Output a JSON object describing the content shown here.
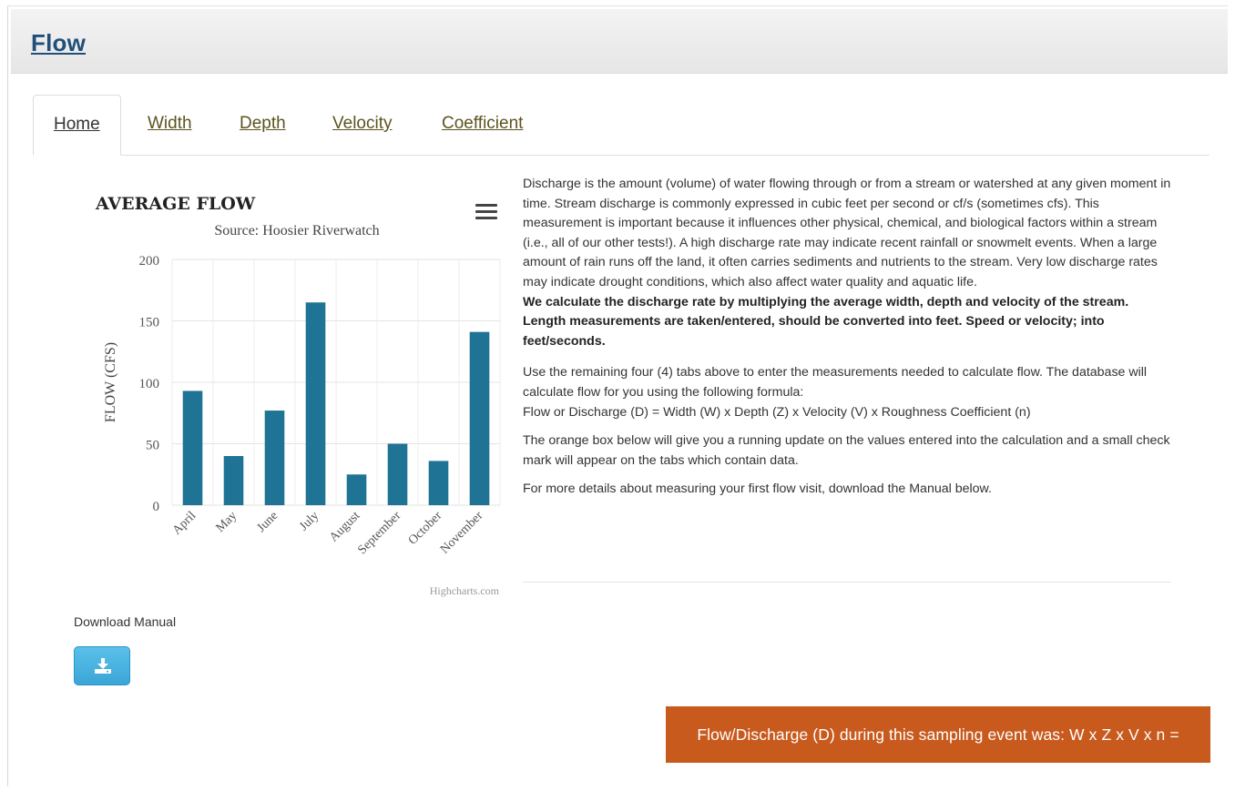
{
  "header": {
    "title": "Flow"
  },
  "tabs": [
    {
      "label": "Home",
      "active": true
    },
    {
      "label": "Width",
      "active": false
    },
    {
      "label": "Depth",
      "active": false
    },
    {
      "label": "Velocity",
      "active": false
    },
    {
      "label": "Coefficient",
      "active": false
    }
  ],
  "chart_data": {
    "type": "bar",
    "title": "AVERAGE FLOW",
    "subtitle": "Source: Hoosier Riverwatch",
    "ylabel": "FLOW (CFS)",
    "xlabel": "",
    "categories": [
      "April",
      "May",
      "June",
      "July",
      "August",
      "September",
      "October",
      "November"
    ],
    "values": [
      93,
      40,
      77,
      165,
      25,
      50,
      36,
      141
    ],
    "ylim": [
      0,
      200
    ],
    "yticks": [
      0,
      50,
      100,
      150,
      200
    ],
    "grid": true,
    "legend": "none",
    "bar_color": "#1f7394",
    "credits": "Highcharts.com"
  },
  "description": {
    "p1": "Discharge is the amount (volume) of water flowing through or from a stream or watershed at any given moment in time. Stream discharge is commonly expressed in cubic feet per second or cf/s (sometimes cfs).  This measurement is important because it influences other physical, chemical, and biological factors within a stream (i.e., all of our other tests!). A high discharge rate may indicate recent rainfall or snowmelt events. When a large amount of rain runs off the land, it often carries sediments and nutrients to the stream. Very low discharge rates may indicate drought conditions, which also affect water quality and aquatic life.",
    "p1_bold": "We calculate the discharge rate by multiplying the average width, depth and velocity of the stream. Length measurements are taken/entered, should be converted into feet.  Speed or velocity; into feet/seconds.",
    "p2": "Use the remaining four (4) tabs above to enter the measurements needed to calculate flow.  The database will calculate flow for you using the following formula:",
    "p2_formula": "Flow or Discharge (D) = Width (W) x Depth (Z) x Velocity (V) x Roughness Coefficient (n)",
    "p3": "The orange box below will give you a running update on the values entered into the calculation and a small check mark will appear on the tabs which contain data.",
    "p4": "For more details about measuring your first flow visit, download the Manual below."
  },
  "download": {
    "label": "Download Manual",
    "icon": "download-icon"
  },
  "result": {
    "text": "Flow/Discharge (D) during this sampling event was: W x Z x V x n ="
  },
  "colors": {
    "accent": "#1f4f7a",
    "result_bg": "#c85a1e",
    "button": "#3aa6d6"
  }
}
